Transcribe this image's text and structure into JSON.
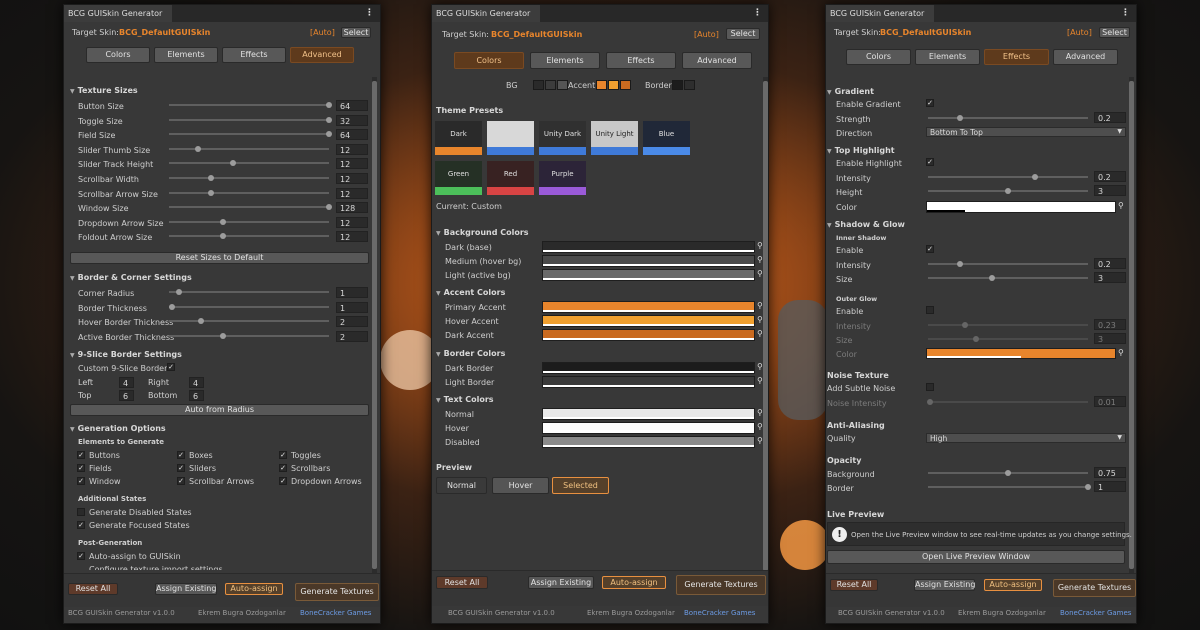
{
  "theme": {
    "accent": "#e8852c",
    "link_blue": "#6c9be4",
    "panel_bg": "#383838"
  },
  "p1": {
    "title": "BCG GUISkin Generator",
    "target_label": "Target Skin:",
    "target_value": "BCG_DefaultGUISkin",
    "auto_label": "[Auto]",
    "select_label": "Select",
    "tabs": [
      "Colors",
      "Elements",
      "Effects",
      "Advanced"
    ],
    "texture_sizes_title": "Texture Sizes",
    "texture_sizes": [
      {
        "label": "Button Size",
        "value": "64",
        "level": 1
      },
      {
        "label": "Toggle Size",
        "value": "32",
        "level": 1
      },
      {
        "label": "Field Size",
        "value": "64",
        "level": 1
      },
      {
        "label": "Slider Thumb Size",
        "value": "12",
        "level": 0.18
      },
      {
        "label": "Slider Track Height",
        "value": "12",
        "level": 0.4
      },
      {
        "label": "Scrollbar Width",
        "value": "12",
        "level": 0.26
      },
      {
        "label": "Scrollbar Arrow Size",
        "value": "12",
        "level": 0.26
      },
      {
        "label": "Window Size",
        "value": "128",
        "level": 1
      },
      {
        "label": "Dropdown Arrow Size",
        "value": "12",
        "level": 0.34
      },
      {
        "label": "Foldout Arrow Size",
        "value": "12",
        "level": 0.34
      }
    ],
    "reset_sizes": "Reset Sizes to Default",
    "border_title": "Border & Corner Settings",
    "border_items": [
      {
        "label": "Corner Radius",
        "value": "1",
        "level": 0.06
      },
      {
        "label": "Border Thickness",
        "value": "1",
        "level": 0.02
      },
      {
        "label": "Hover Border Thickness",
        "value": "2",
        "level": 0.2
      },
      {
        "label": "Active Border Thickness",
        "value": "2",
        "level": 0.34
      }
    ],
    "nine_slice_title": "9-Slice Border Settings",
    "custom_borders": "Custom 9-Slice Borders",
    "left_label": "Left",
    "left_value": "4",
    "right_label": "Right",
    "right_value": "4",
    "top_label": "Top",
    "top_value": "6",
    "bottom_label": "Bottom",
    "bottom_value": "6",
    "auto_radius": "Auto from Radius",
    "gen_title": "Generation Options",
    "elements_title": "Elements to Generate",
    "elements": [
      "Buttons",
      "Boxes",
      "Toggles",
      "Fields",
      "Sliders",
      "Scrollbars",
      "Window",
      "Scrollbar Arrows",
      "Dropdown Arrows"
    ],
    "additional_title": "Additional States",
    "gen_disabled": "Generate Disabled States",
    "gen_focused": "Generate Focused States",
    "post_title": "Post-Generation",
    "auto_assign_to": "Auto-assign to GUISkin",
    "config_import": "Configure texture import settings",
    "reset_all": "Reset All",
    "assign_existing": "Assign Existing",
    "auto_assign": "Auto-assign",
    "generate": "Generate Textures",
    "footer_version": "BCG GUISkin Generator v1.0.0",
    "footer_author": "Ekrem Bugra Ozdoganlar",
    "footer_company": "BoneCracker Games"
  },
  "p2": {
    "title": "BCG GUISkin Generator",
    "target_label": "Target Skin:",
    "target_value": "BCG_DefaultGUISkin",
    "auto_label": "[Auto]",
    "select_label": "Select",
    "tabs": [
      "Colors",
      "Elements",
      "Effects",
      "Advanced"
    ],
    "bg_label": "BG",
    "accent_label": "Accent",
    "border_label": "Border",
    "bg_chips": [
      "#2a2a2a",
      "#3c3c3c",
      "#555555"
    ],
    "accent_chips": [
      "#e8852c",
      "#f0a030",
      "#c96a20"
    ],
    "border_chips": [
      "#1c1c1c",
      "#2e2e2e"
    ],
    "presets_title": "Theme Presets",
    "presets": [
      {
        "name": "Dark",
        "bg": "#2a2a2a",
        "bar": "#e8852c",
        "fg": "#e0e0e0"
      },
      {
        "name": "",
        "bg": "#d8d8d8",
        "bar": "#3f7ad8",
        "fg": "#222222"
      },
      {
        "name": "Unity Dark",
        "bg": "#303030",
        "bar": "#3f7ad8",
        "fg": "#e0e0e0"
      },
      {
        "name": "Unity Light",
        "bg": "#c8c8c8",
        "bar": "#3f7ad8",
        "fg": "#222222"
      },
      {
        "name": "Blue",
        "bg": "#202838",
        "bar": "#4a8ae8",
        "fg": "#e0e0e0"
      },
      {
        "name": "Green",
        "bg": "#253025",
        "bar": "#4cbf5a",
        "fg": "#e0e0e0"
      },
      {
        "name": "Red",
        "bg": "#382222",
        "bar": "#d84444",
        "fg": "#e0e0e0"
      },
      {
        "name": "Purple",
        "bg": "#2c2438",
        "bar": "#9a5ad8",
        "fg": "#e0e0e0"
      }
    ],
    "current_label": "Current: Custom",
    "bg_colors_title": "Background Colors",
    "bg_colors": [
      {
        "label": "Dark (base)",
        "color": "#2a2a2a"
      },
      {
        "label": "Medium (hover bg)",
        "color": "#4a4a4a"
      },
      {
        "label": "Light (active bg)",
        "color": "#6a6a6a"
      }
    ],
    "accent_colors_title": "Accent Colors",
    "accent_colors": [
      {
        "label": "Primary Accent",
        "color": "#e8852c"
      },
      {
        "label": "Hover Accent",
        "color": "#f0a030"
      },
      {
        "label": "Dark Accent",
        "color": "#c96a20"
      }
    ],
    "border_colors_title": "Border Colors",
    "border_colors": [
      {
        "label": "Dark Border",
        "color": "#1c1c1c"
      },
      {
        "label": "Light Border",
        "color": "#3a3a3a"
      }
    ],
    "text_colors_title": "Text Colors",
    "text_colors": [
      {
        "label": "Normal",
        "color": "#e8e8e8"
      },
      {
        "label": "Hover",
        "color": "#ffffff"
      },
      {
        "label": "Disabled",
        "color": "#8a8a8a"
      }
    ],
    "preview_title": "Preview",
    "preview_normal": "Normal",
    "preview_hover": "Hover",
    "preview_selected": "Selected",
    "reset_all": "Reset All",
    "assign_existing": "Assign Existing",
    "auto_assign": "Auto-assign",
    "generate": "Generate Textures",
    "footer_version": "BCG GUISkin Generator v1.0.0",
    "footer_author": "Ekrem Bugra Ozdoganlar",
    "footer_company": "BoneCracker Games"
  },
  "p3": {
    "title": "BCG GUISkin Generator",
    "target_label": "Target Skin:",
    "target_value": "BCG_DefaultGUISkin",
    "auto_label": "[Auto]",
    "select_label": "Select",
    "tabs": [
      "Colors",
      "Elements",
      "Effects",
      "Advanced"
    ],
    "gradient_title": "Gradient",
    "enable_gradient": "Enable Gradient",
    "strength_label": "Strength",
    "strength_value": "0.2",
    "strength_level": 0.2,
    "direction_label": "Direction",
    "direction_value": "Bottom To Top",
    "highlight_title": "Top Highlight",
    "enable_highlight": "Enable Highlight",
    "hl_intensity_label": "Intensity",
    "hl_intensity_value": "0.2",
    "hl_intensity_level": 0.67,
    "hl_height_label": "Height",
    "hl_height_value": "3",
    "hl_height_level": 0.5,
    "hl_color_label": "Color",
    "hl_color": "#ffffff",
    "shadow_title": "Shadow & Glow",
    "inner_shadow": "Inner Shadow",
    "is_enable": "Enable",
    "is_intensity_label": "Intensity",
    "is_intensity_value": "0.2",
    "is_intensity_level": 0.2,
    "is_size_label": "Size",
    "is_size_value": "3",
    "is_size_level": 0.4,
    "outer_glow": "Outer Glow",
    "og_enable": "Enable",
    "og_intensity_label": "Intensity",
    "og_intensity_value": "0.23",
    "og_intensity_level": 0.23,
    "og_size_label": "Size",
    "og_size_value": "3",
    "og_size_level": 0.3,
    "og_color_label": "Color",
    "og_color": "#e8852c",
    "noise_title": "Noise Texture",
    "add_noise": "Add Subtle Noise",
    "noise_intensity_label": "Noise Intensity",
    "noise_intensity_value": "0.01",
    "noise_intensity_level": 0.01,
    "aa_title": "Anti-Aliasing",
    "quality_label": "Quality",
    "quality_value": "High",
    "opacity_title": "Opacity",
    "op_bg_label": "Background",
    "op_bg_value": "0.75",
    "op_bg_level": 0.5,
    "op_border_label": "Border",
    "op_border_value": "1",
    "op_border_level": 1,
    "live_title": "Live Preview",
    "live_info": "Open the Live Preview window to see real-time updates as you change settings.",
    "open_live": "Open Live Preview Window",
    "reset_all": "Reset All",
    "assign_existing": "Assign Existing",
    "auto_assign": "Auto-assign",
    "generate": "Generate Textures",
    "footer_version": "BCG GUISkin Generator v1.0.0",
    "footer_author": "Ekrem Bugra Ozdoganlar",
    "footer_company": "BoneCracker Games"
  }
}
